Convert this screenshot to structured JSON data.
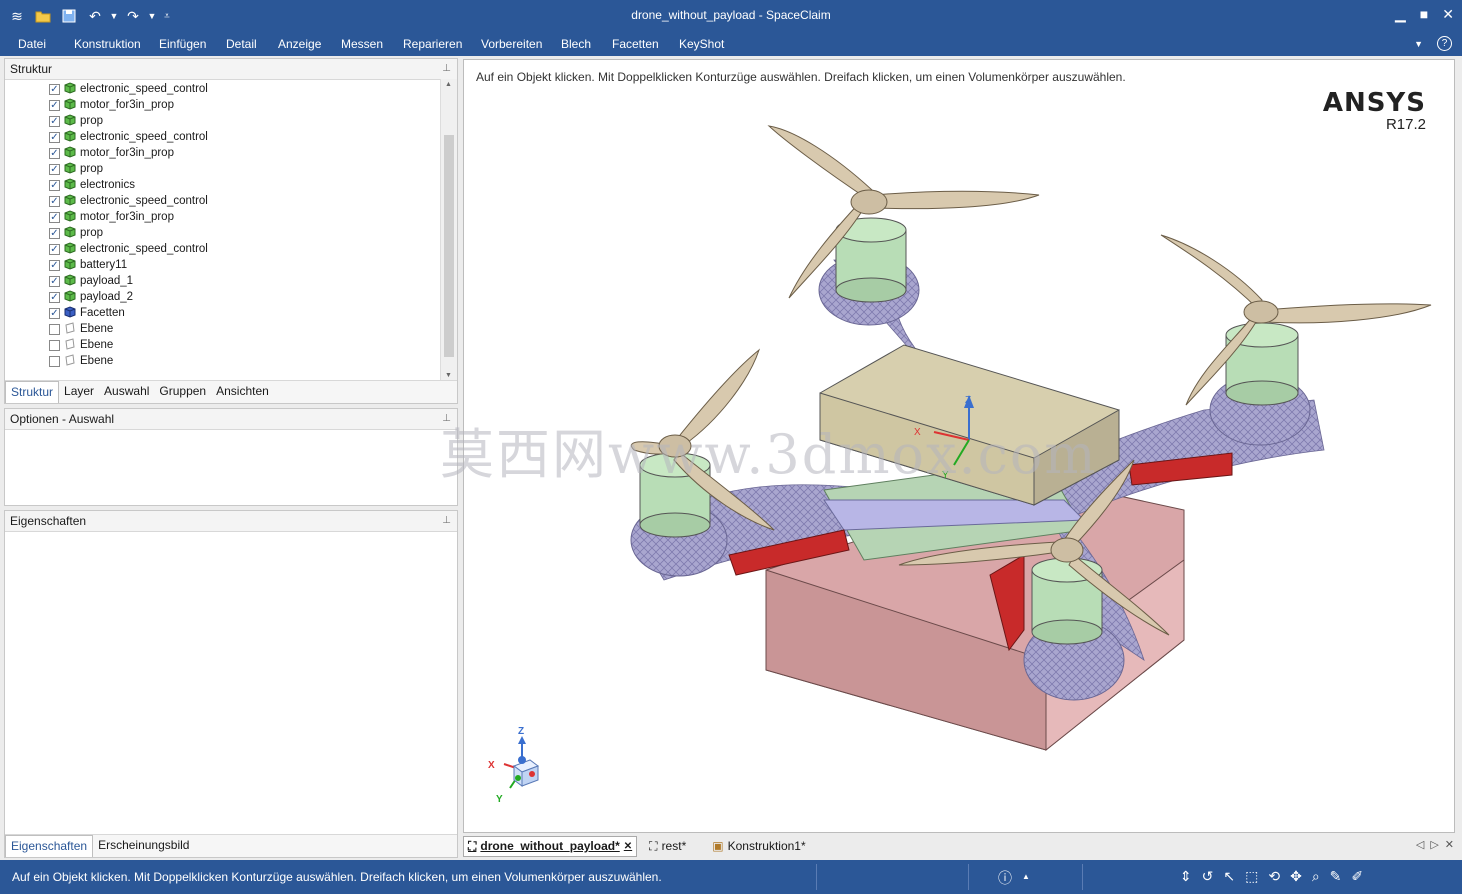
{
  "window": {
    "title": "drone_without_payload - SpaceClaim"
  },
  "menu": [
    "Datei",
    "Konstruktion",
    "Einfügen",
    "Detail",
    "Anzeige",
    "Messen",
    "Reparieren",
    "Vorbereiten",
    "Blech",
    "Facetten",
    "KeyShot"
  ],
  "structure": {
    "title": "Struktur",
    "items": [
      {
        "label": "electronic_speed_control",
        "checked": true,
        "icon": "green-cube"
      },
      {
        "label": "motor_for3in_prop",
        "checked": true,
        "icon": "green-cube"
      },
      {
        "label": "prop",
        "checked": true,
        "icon": "green-cube"
      },
      {
        "label": "electronic_speed_control",
        "checked": true,
        "icon": "green-cube"
      },
      {
        "label": "motor_for3in_prop",
        "checked": true,
        "icon": "green-cube"
      },
      {
        "label": "prop",
        "checked": true,
        "icon": "green-cube"
      },
      {
        "label": "electronics",
        "checked": true,
        "icon": "green-cube"
      },
      {
        "label": "electronic_speed_control",
        "checked": true,
        "icon": "green-cube"
      },
      {
        "label": "motor_for3in_prop",
        "checked": true,
        "icon": "green-cube"
      },
      {
        "label": "prop",
        "checked": true,
        "icon": "green-cube"
      },
      {
        "label": "electronic_speed_control",
        "checked": true,
        "icon": "green-cube"
      },
      {
        "label": "battery11",
        "checked": true,
        "icon": "green-cube"
      },
      {
        "label": "payload_1",
        "checked": true,
        "icon": "green-cube"
      },
      {
        "label": "payload_2",
        "checked": true,
        "icon": "green-cube"
      },
      {
        "label": "Facetten",
        "checked": true,
        "icon": "blue-cube"
      },
      {
        "label": "Ebene",
        "checked": false,
        "icon": "plane"
      },
      {
        "label": "Ebene",
        "checked": false,
        "icon": "plane"
      },
      {
        "label": "Ebene",
        "checked": false,
        "icon": "plane"
      }
    ],
    "tabs": [
      "Struktur",
      "Layer",
      "Auswahl",
      "Gruppen",
      "Ansichten"
    ]
  },
  "options": {
    "title": "Optionen - Auswahl"
  },
  "properties": {
    "title": "Eigenschaften",
    "tabs": [
      "Eigenschaften",
      "Erscheinungsbild"
    ]
  },
  "viewport": {
    "hint": "Auf ein Objekt klicken. Mit Doppelklicken Konturzüge auswählen. Dreifach klicken, um einen Volumenkörper auszuwählen.",
    "brand": "ANSYS",
    "version": "R17.2",
    "watermark": "莫西网www.3dmox.com",
    "axes": {
      "x": "X",
      "y": "Y",
      "z": "Z"
    }
  },
  "doc_tabs": [
    "drone_without_payload*",
    "rest*",
    "Konstruktion1*"
  ],
  "status": {
    "message": "Auf ein Objekt klicken. Mit Doppelklicken Konturzüge auswählen. Dreifach klicken, um einen Volumenkörper auszuwählen."
  },
  "colors": {
    "chrome": "#2b5797",
    "accent": "#2b5797"
  }
}
